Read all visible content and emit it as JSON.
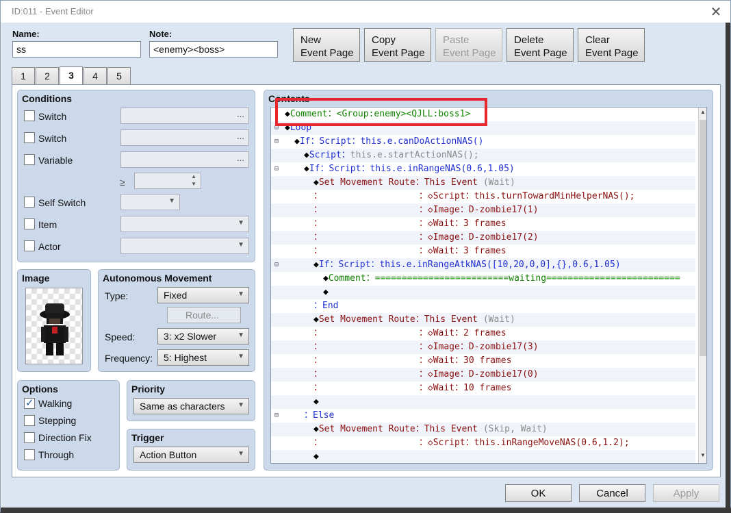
{
  "window": {
    "title": "ID:011 - Event Editor",
    "close_glyph": "✕"
  },
  "name": {
    "label": "Name:",
    "value": "ss"
  },
  "note": {
    "label": "Note:",
    "value": "<enemy><boss>"
  },
  "toolbar": {
    "new": [
      "New",
      "Event Page"
    ],
    "copy": [
      "Copy",
      "Event Page"
    ],
    "paste": [
      "Paste",
      "Event Page"
    ],
    "delete": [
      "Delete",
      "Event Page"
    ],
    "clear": [
      "Clear",
      "Event Page"
    ]
  },
  "tabs": [
    "1",
    "2",
    "3",
    "4",
    "5"
  ],
  "active_tab": "3",
  "conditions": {
    "title": "Conditions",
    "items": [
      {
        "label": "Switch",
        "checked": false
      },
      {
        "label": "Switch",
        "checked": false
      },
      {
        "label": "Variable",
        "checked": false
      },
      {
        "label": "Self Switch",
        "checked": false
      },
      {
        "label": "Item",
        "checked": false
      },
      {
        "label": "Actor",
        "checked": false
      }
    ],
    "gte": "≥",
    "ellipsis": "..."
  },
  "image": {
    "title": "Image",
    "icon": "character-sprite-icon"
  },
  "autonomous": {
    "title": "Autonomous Movement",
    "type_label": "Type:",
    "type_value": "Fixed",
    "route_label": "Route...",
    "speed_label": "Speed:",
    "speed_value": "3: x2 Slower",
    "freq_label": "Frequency:",
    "freq_value": "5: Highest"
  },
  "options": {
    "title": "Options",
    "items": [
      {
        "label": "Walking",
        "checked": true
      },
      {
        "label": "Stepping",
        "checked": false
      },
      {
        "label": "Direction Fix",
        "checked": false
      },
      {
        "label": "Through",
        "checked": false
      }
    ]
  },
  "priority": {
    "title": "Priority",
    "value": "Same as characters"
  },
  "trigger": {
    "title": "Trigger",
    "value": "Action Button"
  },
  "contents": {
    "title": "Contents",
    "lines": [
      {
        "fold": "",
        "indent": 0,
        "parts": [
          [
            "blk",
            "◆"
          ],
          [
            "grn",
            "Comment："
          ],
          [
            "grn",
            "<Group:enemy><QJLL:boss1>"
          ]
        ]
      },
      {
        "fold": "⊟",
        "indent": 0,
        "parts": [
          [
            "blk",
            "◆"
          ],
          [
            "blu",
            "Loop"
          ]
        ]
      },
      {
        "fold": "⊟",
        "indent": 1,
        "parts": [
          [
            "blk",
            "◆"
          ],
          [
            "blu",
            "If：Script：this.e.canDoActionNAS()"
          ]
        ]
      },
      {
        "fold": "",
        "indent": 2,
        "parts": [
          [
            "blk",
            "◆"
          ],
          [
            "blu",
            "Script："
          ],
          [
            "gry",
            "this.e.startActionNAS();"
          ]
        ]
      },
      {
        "fold": "⊟",
        "indent": 2,
        "parts": [
          [
            "blk",
            "◆"
          ],
          [
            "blu",
            "If：Script：this.e.inRangeNAS(0.6,1.05)"
          ]
        ]
      },
      {
        "fold": "",
        "indent": 3,
        "parts": [
          [
            "blk",
            "◆"
          ],
          [
            "red",
            "Set Movement Route：This Event "
          ],
          [
            "gry",
            "(Wait)"
          ]
        ]
      },
      {
        "fold": "",
        "indent": 3,
        "parts": [
          [
            "red",
            "：                  ：◇Script：this.turnTowardMinHelperNAS();"
          ]
        ]
      },
      {
        "fold": "",
        "indent": 3,
        "parts": [
          [
            "red",
            "：                  ：◇Image：D-zombie17(1)"
          ]
        ]
      },
      {
        "fold": "",
        "indent": 3,
        "parts": [
          [
            "red",
            "：                  ：◇Wait：3 frames"
          ]
        ]
      },
      {
        "fold": "",
        "indent": 3,
        "parts": [
          [
            "red",
            "：                  ：◇Image：D-zombie17(2)"
          ]
        ]
      },
      {
        "fold": "",
        "indent": 3,
        "parts": [
          [
            "red",
            "：                  ：◇Wait：3 frames"
          ]
        ]
      },
      {
        "fold": "⊟",
        "indent": 3,
        "parts": [
          [
            "blk",
            "◆"
          ],
          [
            "blu",
            "If：Script：this.e.inRangeAtkNAS([10,20,0,0],{},0.6,1.05)"
          ]
        ]
      },
      {
        "fold": "",
        "indent": 4,
        "parts": [
          [
            "blk",
            "◆"
          ],
          [
            "grn",
            "Comment：=========================waiting========================="
          ]
        ]
      },
      {
        "fold": "",
        "indent": 4,
        "parts": [
          [
            "blk",
            "◆"
          ]
        ]
      },
      {
        "fold": "",
        "indent": 3,
        "parts": [
          [
            "blu",
            "：End"
          ]
        ]
      },
      {
        "fold": "",
        "indent": 3,
        "parts": [
          [
            "blk",
            "◆"
          ],
          [
            "red",
            "Set Movement Route：This Event "
          ],
          [
            "gry",
            "(Wait)"
          ]
        ]
      },
      {
        "fold": "",
        "indent": 3,
        "parts": [
          [
            "red",
            "：                  ：◇Wait：2 frames"
          ]
        ]
      },
      {
        "fold": "",
        "indent": 3,
        "parts": [
          [
            "red",
            "：                  ：◇Image：D-zombie17(3)"
          ]
        ]
      },
      {
        "fold": "",
        "indent": 3,
        "parts": [
          [
            "red",
            "：                  ：◇Wait：30 frames"
          ]
        ]
      },
      {
        "fold": "",
        "indent": 3,
        "parts": [
          [
            "red",
            "：                  ：◇Image：D-zombie17(0)"
          ]
        ]
      },
      {
        "fold": "",
        "indent": 3,
        "parts": [
          [
            "red",
            "：                  ：◇Wait：10 frames"
          ]
        ]
      },
      {
        "fold": "",
        "indent": 3,
        "parts": [
          [
            "blk",
            "◆"
          ]
        ]
      },
      {
        "fold": "⊟",
        "indent": 2,
        "parts": [
          [
            "blu",
            "：Else"
          ]
        ]
      },
      {
        "fold": "",
        "indent": 3,
        "parts": [
          [
            "blk",
            "◆"
          ],
          [
            "red",
            "Set Movement Route：This Event "
          ],
          [
            "gry",
            "(Skip, Wait)"
          ]
        ]
      },
      {
        "fold": "",
        "indent": 3,
        "parts": [
          [
            "red",
            "：                  ：◇Script：this.inRangeMoveNAS(0.6,1.2);"
          ]
        ]
      },
      {
        "fold": "",
        "indent": 3,
        "parts": [
          [
            "blk",
            "◆"
          ]
        ]
      }
    ]
  },
  "footer": {
    "ok": "OK",
    "cancel": "Cancel",
    "apply": "Apply"
  },
  "colors": {
    "highlight": "#e8262e",
    "panel": "#cbd9ea",
    "window_bg": "#dce6f2"
  }
}
